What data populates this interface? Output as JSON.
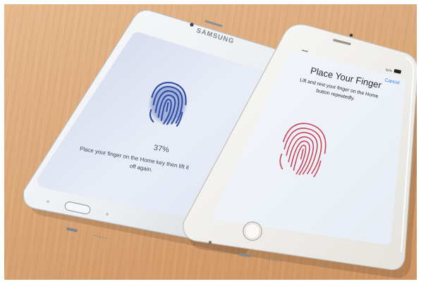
{
  "samsung": {
    "brand": "SAMSUNG",
    "progress_text": "37%",
    "progress": 0.37,
    "instruction_lines": [
      "Place your finger on the Home key then lift it",
      "off again."
    ],
    "screen_color": "#e8ecf6",
    "fingerprint_color": "#2f4fa8"
  },
  "iphone": {
    "carrier": "•••••",
    "battery": "91%",
    "cancel_label": "Cancel",
    "title": "Place Your Finger",
    "subtitle_lines": [
      "Lift and rest your finger on the Home",
      "button repeatedly."
    ],
    "accent_color": "#2f7ae5",
    "fingerprint_color": "#c8485a"
  },
  "icons": [
    "fingerprint-icon",
    "home-button-icon",
    "battery-icon",
    "signal-icon"
  ]
}
